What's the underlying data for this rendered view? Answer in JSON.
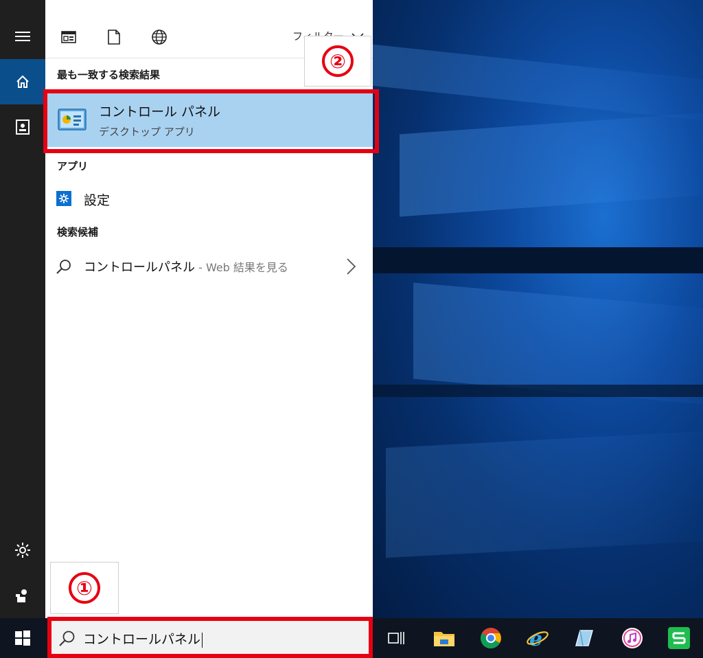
{
  "header": {
    "filter_label": "フィルター"
  },
  "sections": {
    "best_match": "最も一致する検索結果",
    "apps": "アプリ",
    "suggestions": "検索候補"
  },
  "best_match_item": {
    "title": "コントロール パネル",
    "subtitle": "デスクトップ アプリ",
    "icon": "control-panel-icon"
  },
  "apps_items": [
    {
      "label": "設定",
      "icon": "settings-gear-icon"
    }
  ],
  "suggestions_items": [
    {
      "query": "コントロールパネル",
      "hint": " - Web 結果を見る",
      "icon": "search-icon"
    }
  ],
  "search": {
    "value": "コントロールパネル"
  },
  "annotations": {
    "step1": "①",
    "step2": "②",
    "color": "#e60012"
  },
  "colors": {
    "selection": "#a9d2f1",
    "rail_active": "#0a4f8c",
    "taskbar": "#0e1520"
  },
  "rail_icons": [
    "hamburger-menu-icon",
    "home-icon",
    "notebook-icon",
    "settings-icon",
    "feedback-icon"
  ],
  "taskbar_icons": [
    "windows-start-icon",
    "task-view-icon",
    "file-explorer-icon",
    "chrome-icon",
    "internet-explorer-icon",
    "app-icon",
    "itunes-icon",
    "green-app-icon"
  ]
}
